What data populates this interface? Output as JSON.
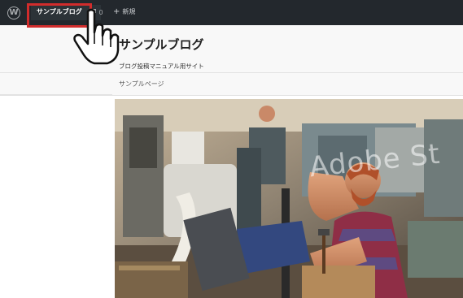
{
  "adminbar": {
    "logo_glyph": "W",
    "site_name": "サンプルブログ",
    "comments_count": "0",
    "new_label": "新規"
  },
  "header": {
    "title": "サンプルブログ",
    "description": "ブログ投稿マニュアル用サイト"
  },
  "nav": {
    "items": [
      {
        "label": "サンプルページ"
      }
    ]
  },
  "hero": {
    "watermark": "Adobe St"
  },
  "colors": {
    "adminbar_bg": "#23282d",
    "highlight": "#d12c2c",
    "header_bg": "#f8f8f8"
  },
  "icons": {
    "logo": "wordpress-logo-icon",
    "comment": "comment-bubble-icon",
    "new": "plus-icon",
    "pointer": "hand-pointer-icon"
  }
}
